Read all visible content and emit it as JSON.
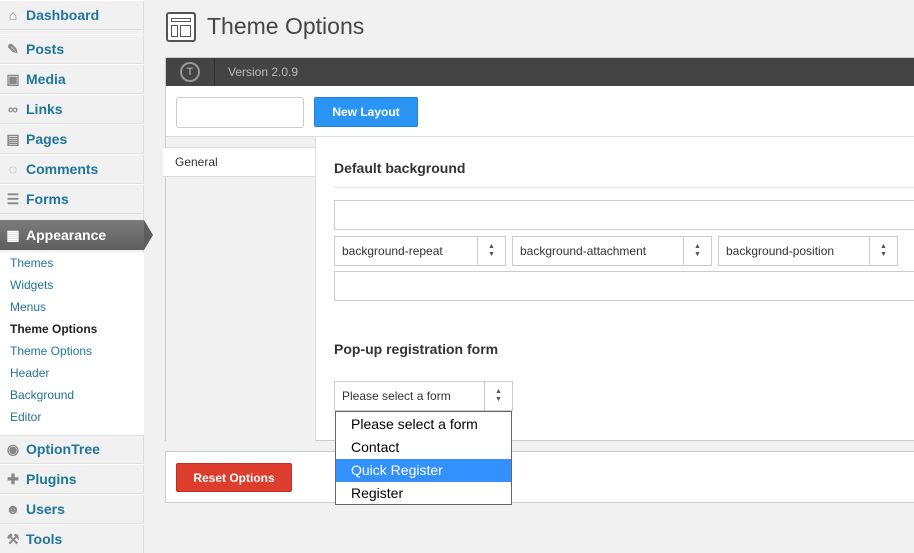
{
  "sidebar": {
    "items": [
      {
        "label": "Dashboard",
        "icon": "dashboard-icon"
      },
      {
        "label": "Posts",
        "icon": "pin-icon"
      },
      {
        "label": "Media",
        "icon": "media-icon"
      },
      {
        "label": "Links",
        "icon": "link-icon"
      },
      {
        "label": "Pages",
        "icon": "pages-icon"
      },
      {
        "label": "Comments",
        "icon": "comment-icon"
      },
      {
        "label": "Forms",
        "icon": "forms-icon"
      },
      {
        "label": "Appearance",
        "icon": "appearance-icon"
      },
      {
        "label": "OptionTree",
        "icon": "optiontree-icon"
      },
      {
        "label": "Plugins",
        "icon": "plugin-icon"
      },
      {
        "label": "Users",
        "icon": "users-icon"
      },
      {
        "label": "Tools",
        "icon": "tools-icon"
      }
    ],
    "appearance_submenu": [
      "Themes",
      "Widgets",
      "Menus",
      "Theme Options",
      "Theme Options",
      "Header",
      "Background",
      "Editor"
    ]
  },
  "header": {
    "title": "Theme Options"
  },
  "topbar": {
    "version": "Version 2.0.9"
  },
  "layout": {
    "input_value": "",
    "new_layout_label": "New Layout"
  },
  "tabs": [
    {
      "label": "General"
    }
  ],
  "sections": {
    "background": {
      "title": "Default background",
      "repeat": "background-repeat",
      "attachment": "background-attachment",
      "position": "background-position"
    },
    "popup": {
      "title": "Pop-up registration form",
      "selected": "Please select a form",
      "options": [
        "Please select a form",
        "Contact",
        "Quick Register",
        "Register"
      ],
      "highlighted": "Quick Register"
    }
  },
  "footer": {
    "reset_label": "Reset Options"
  },
  "colors": {
    "accent_blue": "#2a95f5",
    "reset_red": "#dd3d2d",
    "topbar": "#444444",
    "highlight": "#3390ff"
  }
}
